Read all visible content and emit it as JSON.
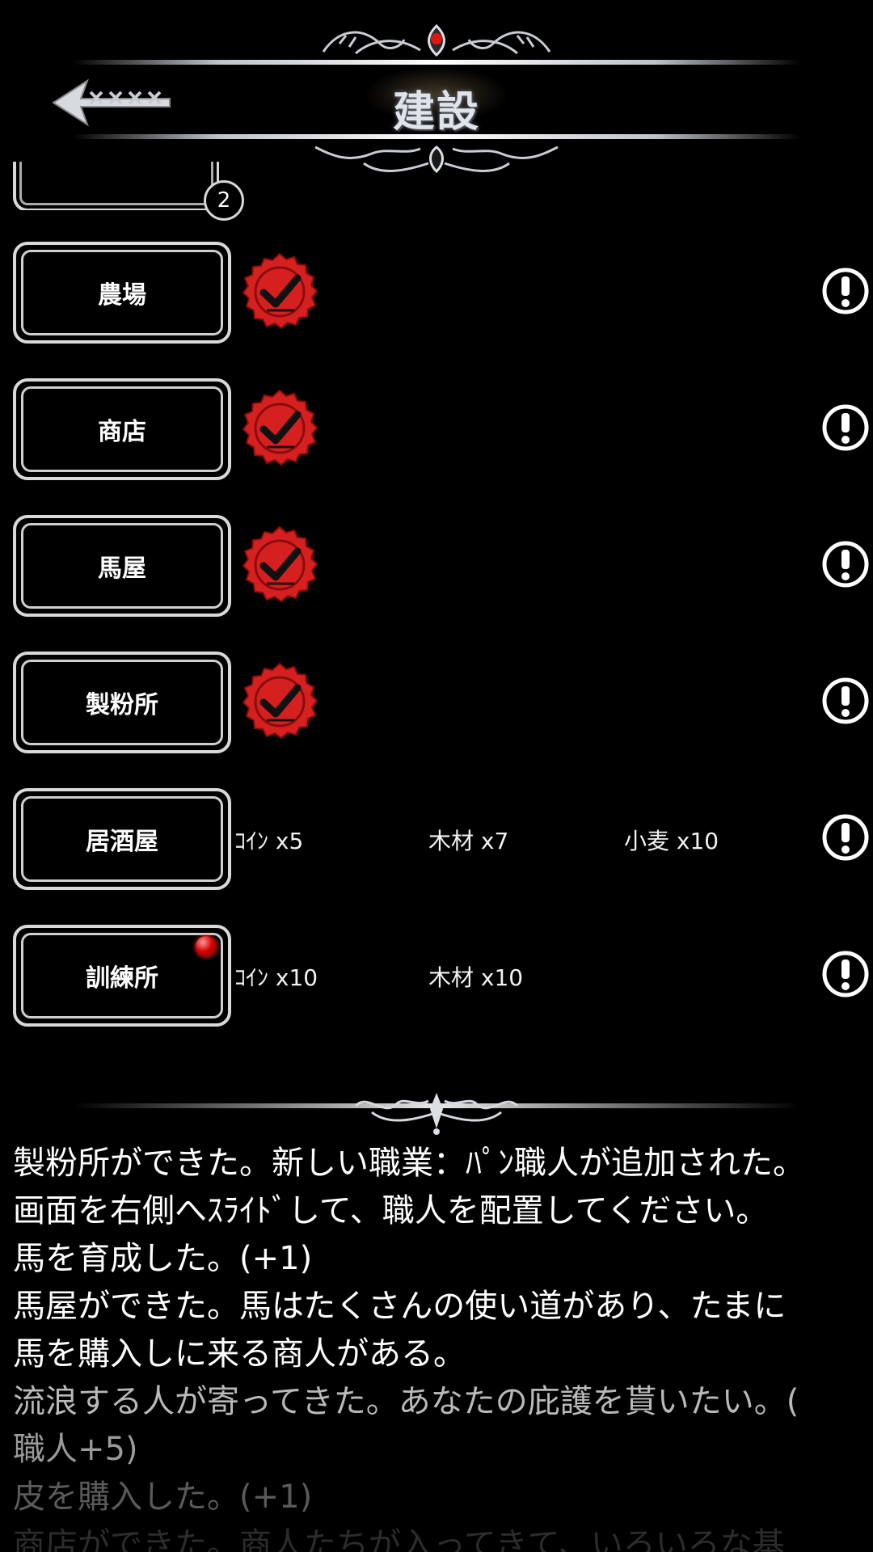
{
  "header": {
    "title": "建設"
  },
  "prev_row": {
    "count": "2"
  },
  "buildings": [
    {
      "label": "農場",
      "status": "built"
    },
    {
      "label": "商店",
      "status": "built"
    },
    {
      "label": "馬屋",
      "status": "built"
    },
    {
      "label": "製粉所",
      "status": "built"
    },
    {
      "label": "居酒屋",
      "status": "cost",
      "costs": [
        "ｺｲﾝ x5",
        "木材 x7",
        "小麦 x10"
      ]
    },
    {
      "label": "訓練所",
      "status": "cost",
      "new_indicator": true,
      "costs": [
        "ｺｲﾝ x10",
        "木材 x10"
      ]
    }
  ],
  "log": [
    "製粉所ができた。新しい職業：ﾊﾟﾝ職人が追加された。",
    "画面を右側へｽﾗｲﾄﾞして、職人を配置してください。",
    "馬を育成した。(+1)",
    "馬屋ができた。馬はたくさんの使い道があり、たまに",
    "馬を購入しに来る商人がある。",
    "流浪する人が寄ってきた。あなたの庇護を貰いたい。(",
    "職人+5)",
    "皮を購入した。(+1)",
    "商店ができた。商人たちが入ってきて、いろいろな基"
  ],
  "colors": {
    "seal": "#d62020",
    "seal_dark": "#8a0c0c",
    "frame": "#d9d9d9",
    "accent_red": "#ff2a2a"
  },
  "icons": {
    "back": "back-arrow-icon",
    "check": "check-seal-icon",
    "info": "exclamation-circle-icon",
    "ornament": "filigree-ornament-icon"
  }
}
